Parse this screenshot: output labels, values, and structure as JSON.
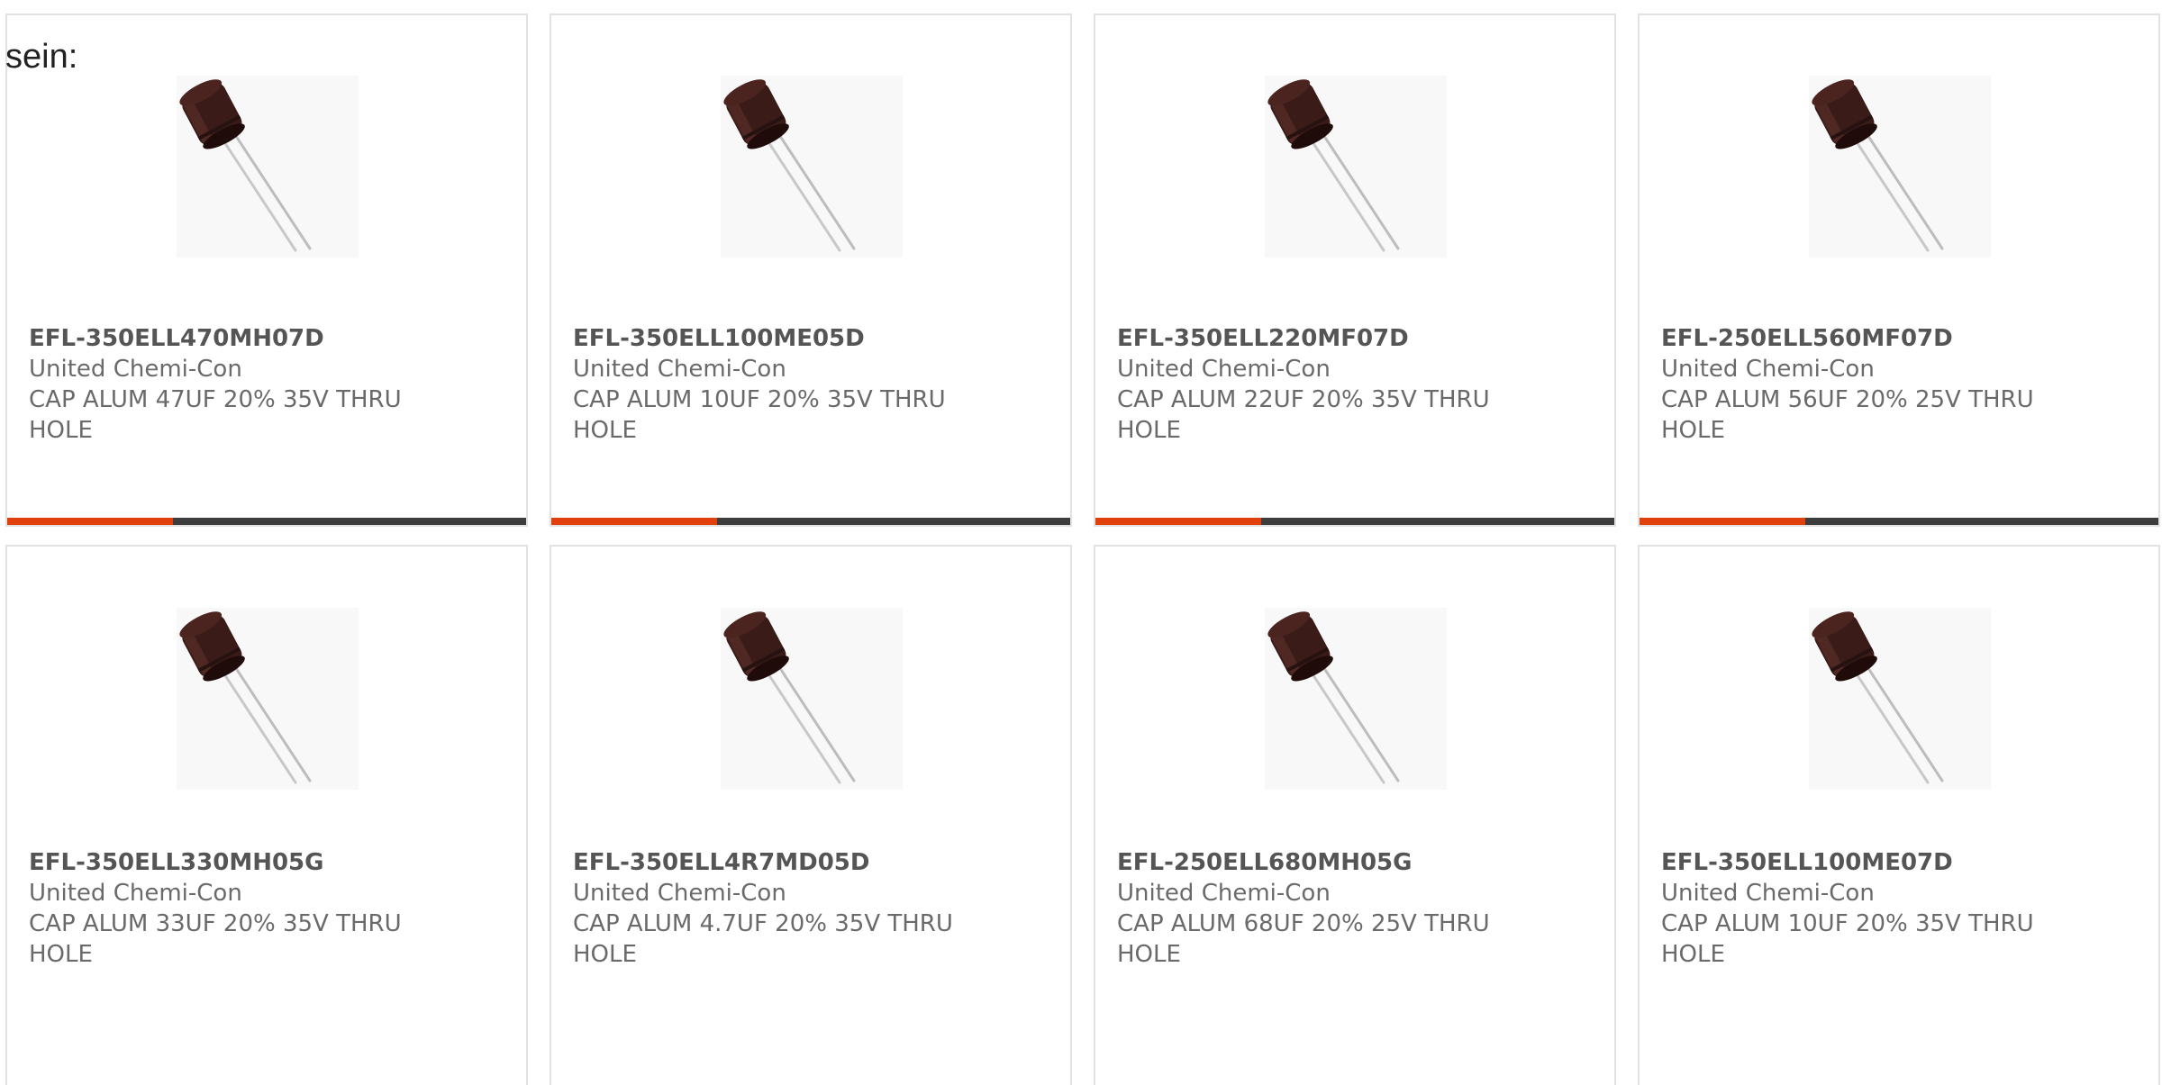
{
  "page": {
    "prefix_text": "sein:"
  },
  "theme": {
    "accent": "#e2400b",
    "bar_dark": "#3d3d3d",
    "card_border": "#e2e2e2",
    "text_muted": "#6a6a6a"
  },
  "products": [
    {
      "part_number": "EFL-350ELL470MH07D",
      "manufacturer": "United Chemi-Con",
      "description": "CAP ALUM 47UF 20% 35V THRU HOLE",
      "image_icon": "capacitor-image"
    },
    {
      "part_number": "EFL-350ELL100ME05D",
      "manufacturer": "United Chemi-Con",
      "description": "CAP ALUM 10UF 20% 35V THRU HOLE",
      "image_icon": "capacitor-image"
    },
    {
      "part_number": "EFL-350ELL220MF07D",
      "manufacturer": "United Chemi-Con",
      "description": "CAP ALUM 22UF 20% 35V THRU HOLE",
      "image_icon": "capacitor-image"
    },
    {
      "part_number": "EFL-250ELL560MF07D",
      "manufacturer": "United Chemi-Con",
      "description": "CAP ALUM 56UF 20% 25V THRU HOLE",
      "image_icon": "capacitor-image"
    },
    {
      "part_number": "EFL-350ELL330MH05G",
      "manufacturer": "United Chemi-Con",
      "description": "CAP ALUM 33UF 20% 35V THRU HOLE",
      "image_icon": "capacitor-image"
    },
    {
      "part_number": "EFL-350ELL4R7MD05D",
      "manufacturer": "United Chemi-Con",
      "description": "CAP ALUM 4.7UF 20% 35V THRU HOLE",
      "image_icon": "capacitor-image"
    },
    {
      "part_number": "EFL-250ELL680MH05G",
      "manufacturer": "United Chemi-Con",
      "description": "CAP ALUM 68UF 20% 25V THRU HOLE",
      "image_icon": "capacitor-image"
    },
    {
      "part_number": "EFL-350ELL100ME07D",
      "manufacturer": "United Chemi-Con",
      "description": "CAP ALUM 10UF 20% 35V THRU HOLE",
      "image_icon": "capacitor-image"
    }
  ]
}
